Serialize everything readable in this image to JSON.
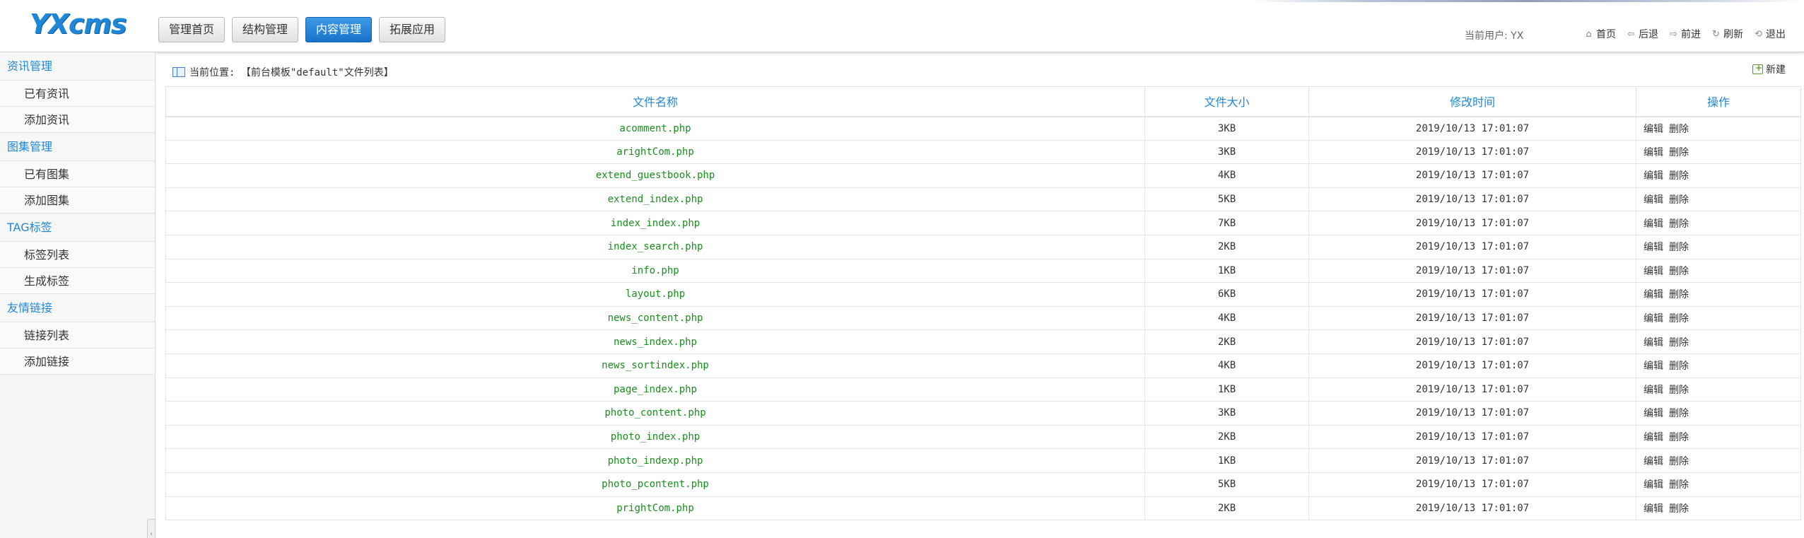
{
  "header": {
    "logo": "YXcms",
    "nav": [
      "管理首页",
      "结构管理",
      "内容管理",
      "拓展应用"
    ],
    "active_nav": "内容管理",
    "user_label": "当前用户: YX",
    "links": [
      {
        "label": "首页",
        "icon": "home-icon"
      },
      {
        "label": "后退",
        "icon": "arrow-left-icon"
      },
      {
        "label": "前进",
        "icon": "arrow-right-icon"
      },
      {
        "label": "刷新",
        "icon": "refresh-icon"
      },
      {
        "label": "退出",
        "icon": "logout-icon"
      }
    ]
  },
  "sidebar": {
    "groups": [
      {
        "title": "资讯管理",
        "items": [
          "已有资讯",
          "添加资讯"
        ]
      },
      {
        "title": "图集管理",
        "items": [
          "已有图集",
          "添加图集"
        ]
      },
      {
        "title": "TAG标签",
        "items": [
          "标签列表",
          "生成标签"
        ]
      },
      {
        "title": "友情链接",
        "items": [
          "链接列表",
          "添加链接"
        ]
      }
    ]
  },
  "main": {
    "breadcrumb": "当前位置: 【前台模板\"default\"文件列表】",
    "new_label": "新建",
    "columns": [
      "文件名称",
      "文件大小",
      "修改时间",
      "操作"
    ],
    "edit_label": "编辑",
    "delete_label": "删除",
    "rows": [
      {
        "name": "acomment.php",
        "size": "3KB",
        "time": "2019/10/13 17:01:07"
      },
      {
        "name": "arightCom.php",
        "size": "3KB",
        "time": "2019/10/13 17:01:07"
      },
      {
        "name": "extend_guestbook.php",
        "size": "4KB",
        "time": "2019/10/13 17:01:07"
      },
      {
        "name": "extend_index.php",
        "size": "5KB",
        "time": "2019/10/13 17:01:07"
      },
      {
        "name": "index_index.php",
        "size": "7KB",
        "time": "2019/10/13 17:01:07"
      },
      {
        "name": "index_search.php",
        "size": "2KB",
        "time": "2019/10/13 17:01:07"
      },
      {
        "name": "info.php",
        "size": "1KB",
        "time": "2019/10/13 17:01:07"
      },
      {
        "name": "layout.php",
        "size": "6KB",
        "time": "2019/10/13 17:01:07"
      },
      {
        "name": "news_content.php",
        "size": "4KB",
        "time": "2019/10/13 17:01:07"
      },
      {
        "name": "news_index.php",
        "size": "2KB",
        "time": "2019/10/13 17:01:07"
      },
      {
        "name": "news_sortindex.php",
        "size": "4KB",
        "time": "2019/10/13 17:01:07"
      },
      {
        "name": "page_index.php",
        "size": "1KB",
        "time": "2019/10/13 17:01:07"
      },
      {
        "name": "photo_content.php",
        "size": "3KB",
        "time": "2019/10/13 17:01:07"
      },
      {
        "name": "photo_index.php",
        "size": "2KB",
        "time": "2019/10/13 17:01:07"
      },
      {
        "name": "photo_indexp.php",
        "size": "1KB",
        "time": "2019/10/13 17:01:07"
      },
      {
        "name": "photo_pcontent.php",
        "size": "5KB",
        "time": "2019/10/13 17:01:07"
      },
      {
        "name": "prightCom.php",
        "size": "2KB",
        "time": "2019/10/13 17:01:07"
      }
    ]
  },
  "colors": {
    "accent": "#1f87d8",
    "filename": "#19901c"
  }
}
